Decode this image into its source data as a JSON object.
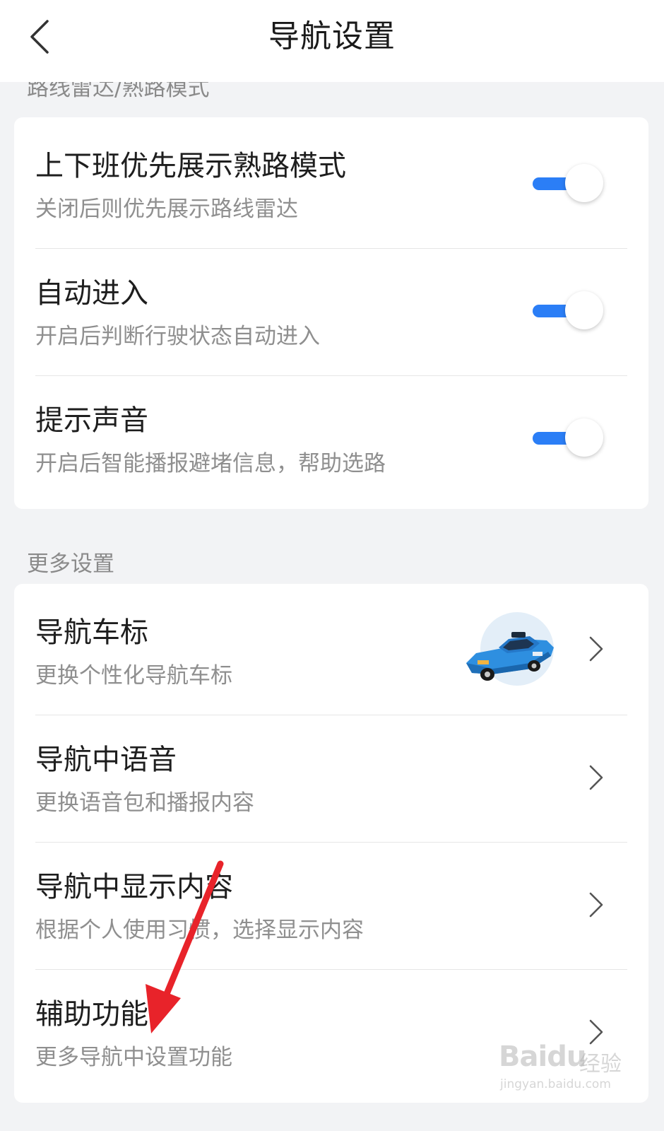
{
  "header": {
    "title": "导航设置",
    "back_icon": "chevron-left-icon"
  },
  "section_route": {
    "label": "路线雷达/熟路模式"
  },
  "toggle_settings": [
    {
      "title": "上下班优先展示熟路模式",
      "subtitle": "关闭后则优先展示路线雷达",
      "enabled": true
    },
    {
      "title": "自动进入",
      "subtitle": "开启后判断行驶状态自动进入",
      "enabled": true
    },
    {
      "title": "提示声音",
      "subtitle": "开启后智能播报避堵信息，帮助选路",
      "enabled": true
    }
  ],
  "section_more": {
    "label": "更多设置"
  },
  "more_settings": [
    {
      "title": "导航车标",
      "subtitle": "更换个性化导航车标",
      "thumbnail": "car-icon"
    },
    {
      "title": "导航中语音",
      "subtitle": "更换语音包和播报内容"
    },
    {
      "title": "导航中显示内容",
      "subtitle": "根据个人使用习惯，选择显示内容"
    },
    {
      "title": "辅助功能",
      "subtitle": "更多导航中设置功能"
    }
  ],
  "watermark": {
    "brand": "Baidu",
    "cn": "经验",
    "url": "jingyan.baidu.com"
  },
  "colors": {
    "accent": "#2b7ef6",
    "annotation_arrow": "#e8232a",
    "background": "#f2f3f5"
  }
}
